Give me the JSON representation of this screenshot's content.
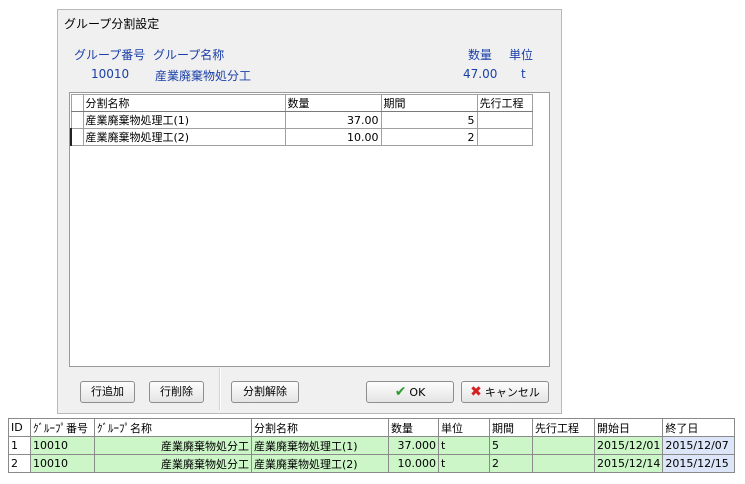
{
  "dialog": {
    "title": "グループ分割設定",
    "header": {
      "group_no_label": "グループ番号",
      "group_name_label": "グループ名称",
      "qty_label": "数量",
      "unit_label": "単位",
      "group_no": "10010",
      "group_name": "産業廃棄物処分工",
      "qty": "47.00",
      "unit": "t"
    },
    "grid": {
      "columns": [
        "分割名称",
        "数量",
        "期間",
        "先行工程"
      ],
      "rows": [
        {
          "name": "産業廃棄物処理工(1)",
          "qty": "37.00",
          "period": "5",
          "pred": ""
        },
        {
          "name": "産業廃棄物処理工(2)",
          "qty": "10.00",
          "period": "2",
          "pred": ""
        }
      ]
    },
    "buttons": {
      "add_row": "行追加",
      "delete_row": "行削除",
      "unsplit": "分割解除",
      "ok": "OK",
      "cancel": "キャンセル"
    }
  },
  "bottom_table": {
    "columns": [
      "ID",
      "ｸﾞﾙｰﾌﾟ番号",
      "ｸﾞﾙｰﾌﾟ名称",
      "分割名称",
      "数量",
      "単位",
      "期間",
      "先行工程",
      "開始日",
      "終了日"
    ],
    "rows": [
      {
        "id": "1",
        "group_no": "10010",
        "group_name": "産業廃棄物処分工",
        "split_name": "産業廃棄物処理工(1)",
        "qty": "37.000",
        "unit": "t",
        "period": "5",
        "pred": "",
        "start": "2015/12/01",
        "end": "2015/12/07"
      },
      {
        "id": "2",
        "group_no": "10010",
        "group_name": "産業廃棄物処分工",
        "split_name": "産業廃棄物処理工(2)",
        "qty": "10.000",
        "unit": "t",
        "period": "2",
        "pred": "",
        "start": "2015/12/14",
        "end": "2015/12/15"
      }
    ]
  },
  "colors": {
    "header_text": "#1a3fa8",
    "row_green": "#ccf5c8",
    "end_date_blue": "#dce6f8",
    "ok_check": "#2f9a2f",
    "cancel_x": "#d42020"
  }
}
